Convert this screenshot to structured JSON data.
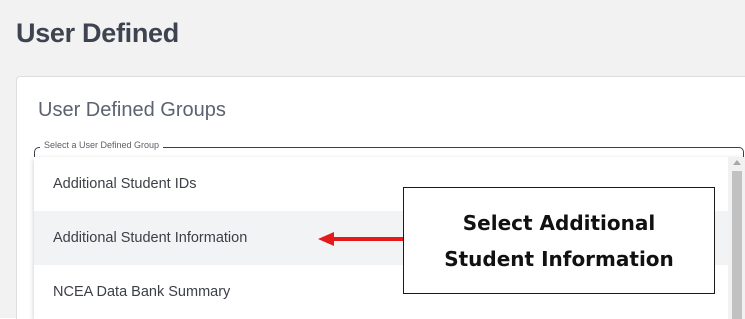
{
  "page": {
    "title": "User Defined"
  },
  "card": {
    "title": "User Defined Groups",
    "select_label": "Select a User Defined Group"
  },
  "dropdown": {
    "options": [
      "Additional Student IDs",
      "Additional Student Information",
      "NCEA Data Bank Summary"
    ],
    "hovered_option": "Additional Student Information"
  },
  "callout": {
    "line1": "Select Additional",
    "line2": "Student Information"
  },
  "colors": {
    "arrow": "#e31b1b",
    "hover_bg": "#f2f3f4",
    "title_text": "#3d4450"
  },
  "icons": {
    "scroll_up": "triangle-up",
    "arrow": "arrow-left"
  }
}
